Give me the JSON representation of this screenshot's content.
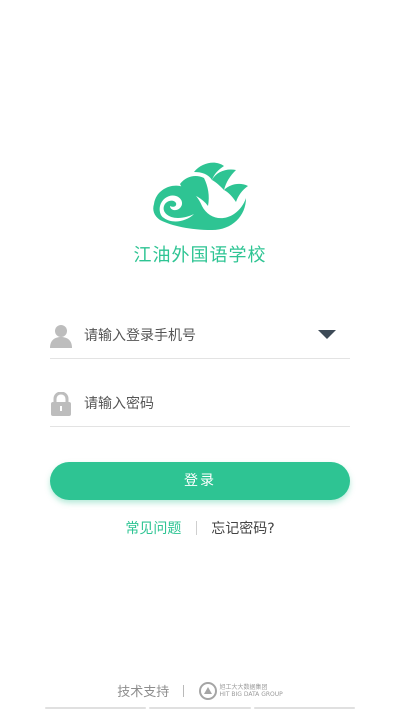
{
  "brand": {
    "school_name": "江油外国语学校",
    "accent_color": "#2ec493",
    "logo_icon": "bird-wing-logo"
  },
  "login_form": {
    "phone": {
      "placeholder": "请输入登录手机号",
      "icon": "user-icon"
    },
    "password": {
      "placeholder": "请输入密码",
      "icon": "lock-icon"
    },
    "submit_label": "登录"
  },
  "links": {
    "faq_label": "常见问题",
    "forgot_label": "忘记密码?"
  },
  "footer": {
    "support_label": "技术支持",
    "group_name": "旭工大大数据集团",
    "group_name_en": "HIT BIG DATA GROUP"
  }
}
